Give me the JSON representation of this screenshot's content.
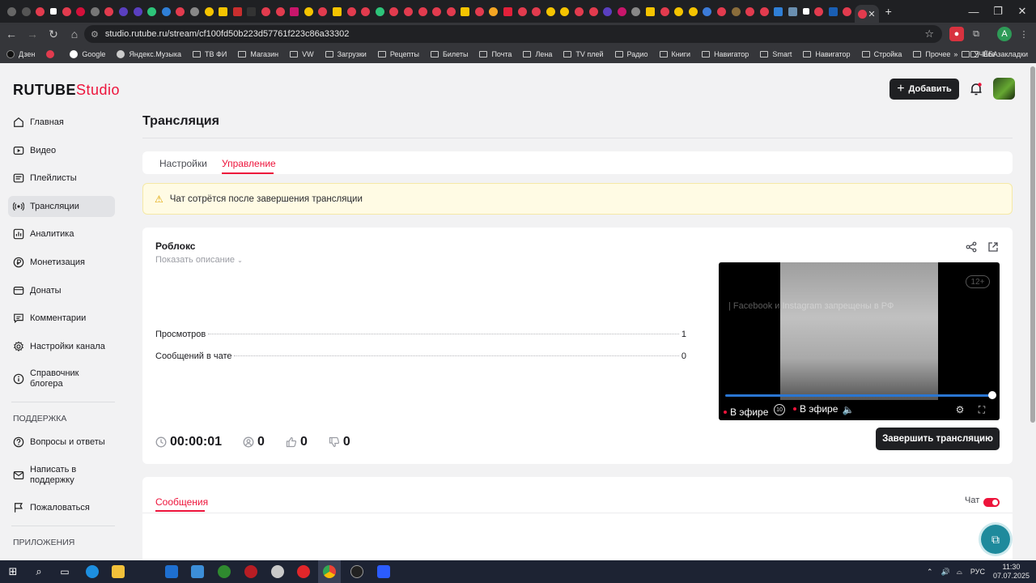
{
  "browser": {
    "url": "studio.rutube.ru/stream/cf100fd50b223d57761f223c86a33302",
    "profile_letter": "A",
    "bookmarks": [
      "Дзен",
      "Google",
      "Яндекс.Музыка",
      "ТВ ФИ",
      "Магазин",
      "VW",
      "Загрузки",
      "Рецепты",
      "Билеты",
      "Почта",
      "Лена",
      "TV плей",
      "Радио",
      "Книги",
      "Навигатор",
      "Smart",
      "Навигатор",
      "Стройка",
      "Прочее",
      "УЧЁБА"
    ],
    "all_bookmarks": "Все закладки"
  },
  "app": {
    "logo_main": "RUTUBE",
    "logo_sub": "Studio",
    "add_button": "Добавить",
    "page_title": "Трансляция"
  },
  "sidebar": {
    "items": [
      {
        "label": "Главная",
        "icon": "home-icon"
      },
      {
        "label": "Видео",
        "icon": "video-icon"
      },
      {
        "label": "Плейлисты",
        "icon": "playlist-icon"
      },
      {
        "label": "Трансляции",
        "icon": "broadcast-icon"
      },
      {
        "label": "Аналитика",
        "icon": "analytics-icon"
      },
      {
        "label": "Монетизация",
        "icon": "ruble-icon"
      },
      {
        "label": "Донаты",
        "icon": "donate-icon"
      },
      {
        "label": "Комментарии",
        "icon": "comments-icon"
      },
      {
        "label": "Настройки канала",
        "icon": "gear-icon"
      },
      {
        "label": "Справочник блогера",
        "icon": "info-icon"
      }
    ],
    "support_title": "ПОДДЕРЖКА",
    "support_items": [
      {
        "label": "Вопросы и ответы",
        "icon": "question-icon"
      },
      {
        "label": "Написать в поддержку",
        "icon": "mail-icon"
      },
      {
        "label": "Пожаловаться",
        "icon": "flag-icon"
      }
    ],
    "apps_title": "ПРИЛОЖЕНИЯ"
  },
  "tabs": {
    "settings": "Настройки",
    "management": "Управление"
  },
  "warning": "Чат сотрётся после завершения трансляции",
  "stream": {
    "title": "Роблокс",
    "show_description": "Показать описание",
    "stats": [
      {
        "label": "Просмотров",
        "value": "1"
      },
      {
        "label": "Сообщений в чате",
        "value": "0"
      }
    ],
    "player": {
      "age_badge": "12+",
      "notice": "| Facebook и Instagram запрещены в РФ",
      "live_left": "В эфире",
      "live_right": "В эфире",
      "rewind_label": "10",
      "progress": 1.0
    },
    "duration": "00:00:01",
    "viewers": "0",
    "likes": "0",
    "dislikes": "0",
    "end_button": "Завершить трансляцию"
  },
  "messages": {
    "tab": "Сообщения",
    "chat_label": "Чат",
    "chat_enabled": true
  },
  "taskbar": {
    "lang": "РУС",
    "time": "11:30",
    "date": "07.07.2025"
  },
  "colors": {
    "accent": "#ed143b",
    "dark_button": "#1f2023",
    "warning_bg": "#fffbe4",
    "player_progress": "#2a76d2"
  }
}
